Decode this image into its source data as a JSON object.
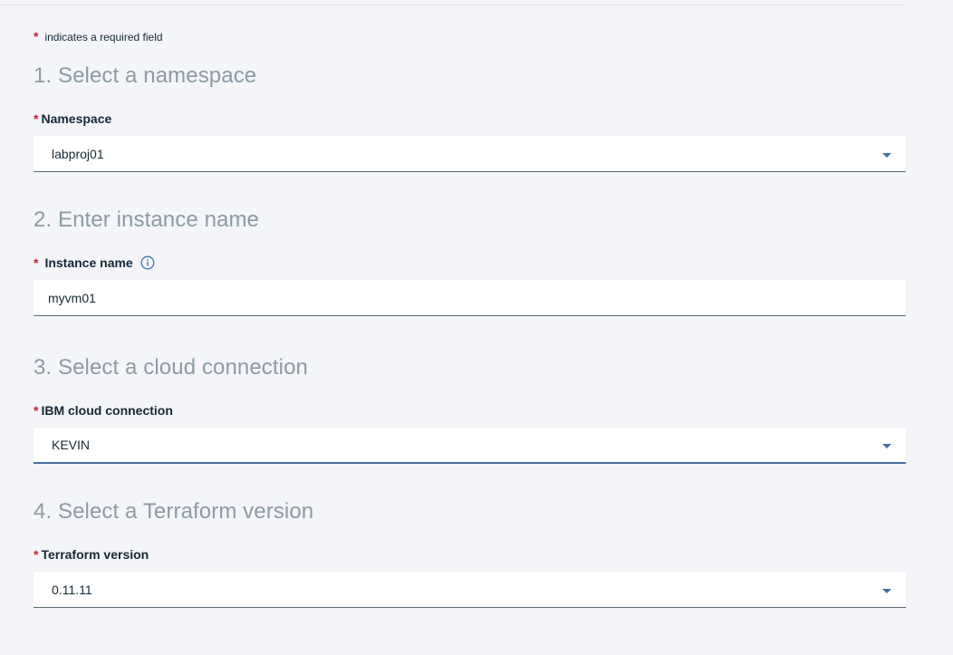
{
  "required_note": {
    "star": "*",
    "text": "indicates a required field"
  },
  "sections": [
    {
      "title": "1. Select a namespace",
      "label": "Namespace",
      "value": "labproj01",
      "control": "dropdown",
      "icon": "chevron-down-icon"
    },
    {
      "title": "2. Enter instance name",
      "label": "Instance name",
      "value": "myvm01",
      "control": "text-input",
      "label_icon": "info-icon"
    },
    {
      "title": "3. Select a cloud connection",
      "label": "IBM cloud connection",
      "value": "KEVIN",
      "control": "dropdown",
      "icon": "chevron-down-icon",
      "focused": true
    },
    {
      "title": "4. Select a Terraform version",
      "label": "Terraform version",
      "value": "0.11.11",
      "control": "dropdown",
      "icon": "chevron-down-icon"
    }
  ],
  "colors": {
    "background": "#f4f5f9",
    "required_star": "#e0182d",
    "section_title": "#8c9ba5",
    "accent": "#3d70b2",
    "text": "#152935"
  }
}
